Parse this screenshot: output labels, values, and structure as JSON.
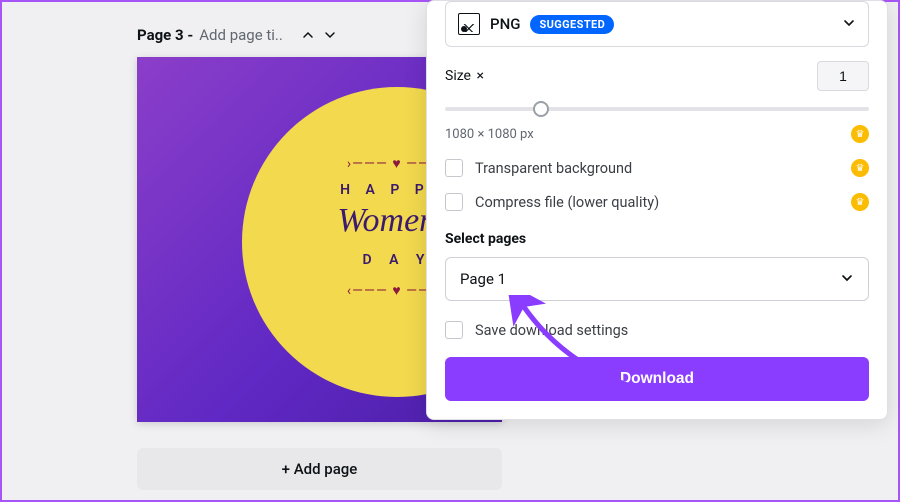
{
  "header": {
    "page_label": "Page 3 - ",
    "placeholder": "Add page ti.."
  },
  "canvas": {
    "happy": "H A P P Y",
    "womens": "Women's",
    "day": "D A Y"
  },
  "add_page_label": "+ Add page",
  "panel": {
    "format": {
      "label": "PNG",
      "badge": "SUGGESTED"
    },
    "size": {
      "label": "Size",
      "mult": "×",
      "value": "1",
      "dims": "1080 × 1080 px"
    },
    "options": {
      "transparent": "Transparent background",
      "compress": "Compress file (lower quality)"
    },
    "select_pages_label": "Select pages",
    "selected_page": "Page 1",
    "save_settings": "Save download settings",
    "download_label": "Download"
  }
}
